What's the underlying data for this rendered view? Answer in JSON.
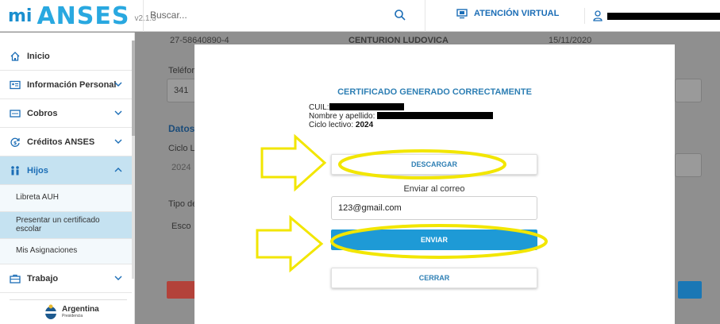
{
  "header": {
    "logo_mi": "mi",
    "logo_anses": "ANSES",
    "version": "v2.1.3",
    "search_placeholder": "Buscar...",
    "virtual_attention": "ATENCIÓN VIRTUAL"
  },
  "sidebar": {
    "items": [
      {
        "label": "Inicio",
        "icon": "home-icon"
      },
      {
        "label": "Información Personal",
        "icon": "id-card-icon"
      },
      {
        "label": "Cobros",
        "icon": "money-icon"
      },
      {
        "label": "Créditos ANSES",
        "icon": "refresh-money-icon"
      },
      {
        "label": "Hijos",
        "icon": "children-icon"
      },
      {
        "label": "Trabajo",
        "icon": "briefcase-icon"
      }
    ],
    "hijos_sub": [
      {
        "label": "Libreta AUH"
      },
      {
        "label": "Presentar un certificado escolar"
      },
      {
        "label": "Mis Asignaciones"
      }
    ],
    "footer": {
      "title": "Argentina",
      "subtitle": "Presidencia"
    }
  },
  "background": {
    "row_cuil": "27-58640890-4",
    "row_name": "CENTURION LUDOVICA",
    "row_date": "15/11/2020",
    "phone_label": "Teléfor",
    "phone_value": "341",
    "section_title": "Datos",
    "ciclo_label": "Ciclo L",
    "ciclo_value": "2024",
    "tipo_label": "Tipo de",
    "tipo_value": "Esco"
  },
  "modal": {
    "title": "CERTIFICADO GENERADO CORRECTAMENTE",
    "cuil_label": "CUIL:",
    "name_label": "Nombre y apellido:",
    "ciclo_label": "Ciclo lectivo:",
    "ciclo_value": "2024",
    "download_button": "DESCARGAR",
    "send_email_label": "Enviar al correo",
    "email_value": "123@gmail.com",
    "send_button": "ENVIAR",
    "close_button": "CERRAR"
  },
  "colors": {
    "brand_blue": "#29a8e0",
    "link_blue": "#2e7fb4",
    "primary_button": "#1e9ad6",
    "highlight_yellow": "#f2e600"
  }
}
